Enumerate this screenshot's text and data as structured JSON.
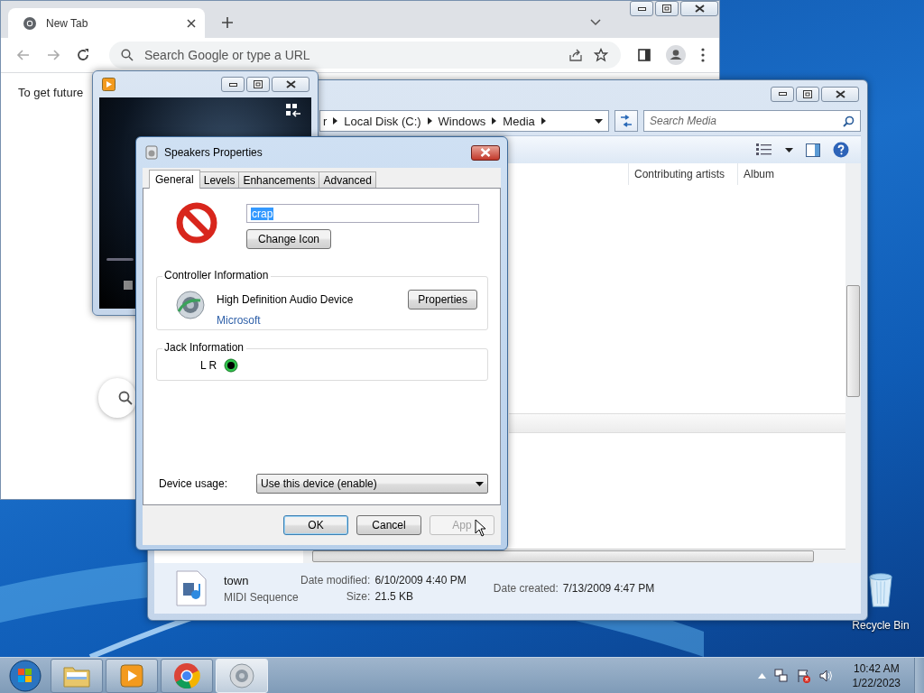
{
  "chrome": {
    "tab": {
      "title": "New Tab",
      "selected": true
    },
    "omnibox": {
      "placeholder": "Search Google or type a URL"
    },
    "page_text": "To get future"
  },
  "explorer": {
    "breadcrumb": [
      "r",
      "Local Disk (C:)",
      "Windows",
      "Media"
    ],
    "search": {
      "placeholder": "Search Media"
    },
    "columns": [
      "Contributing artists",
      "Album"
    ],
    "details": {
      "name": "town",
      "type": "MIDI Sequence",
      "fields": [
        {
          "label": "Date modified:",
          "value": "6/10/2009 4:40 PM"
        },
        {
          "label": "Size:",
          "value": "21.5 KB"
        },
        {
          "label": "Date created:",
          "value": "7/13/2009 4:47 PM"
        }
      ]
    }
  },
  "dialog": {
    "title": "Speakers Properties",
    "tabs": [
      {
        "label": "General",
        "selected": true
      },
      {
        "label": "Levels",
        "selected": false
      },
      {
        "label": "Enhancements",
        "selected": false
      },
      {
        "label": "Advanced",
        "selected": false
      }
    ],
    "name_field": {
      "value": "crap",
      "highlighted": true
    },
    "change_icon_button": "Change Icon",
    "controller": {
      "heading": "Controller Information",
      "device": "High Definition Audio Device",
      "vendor": "Microsoft",
      "button": "Properties"
    },
    "jack": {
      "heading": "Jack Information",
      "label": "L R"
    },
    "device_usage": {
      "label": "Device usage:",
      "value": "Use this device (enable)"
    },
    "buttons": [
      {
        "label": "OK",
        "default": true,
        "disabled": false
      },
      {
        "label": "Cancel",
        "default": false,
        "disabled": false
      },
      {
        "label": "App",
        "default": false,
        "disabled": true
      }
    ]
  },
  "desktop": {
    "icons": [
      {
        "label": "Recycle Bin"
      }
    ]
  },
  "taskbar": {
    "items": [
      {
        "kind": "explorer",
        "selected": false
      },
      {
        "kind": "media-player",
        "selected": false
      },
      {
        "kind": "chrome",
        "selected": false
      },
      {
        "kind": "speaker",
        "selected": true
      }
    ],
    "clock": {
      "time": "10:42 AM",
      "date": "1/22/2023"
    }
  }
}
